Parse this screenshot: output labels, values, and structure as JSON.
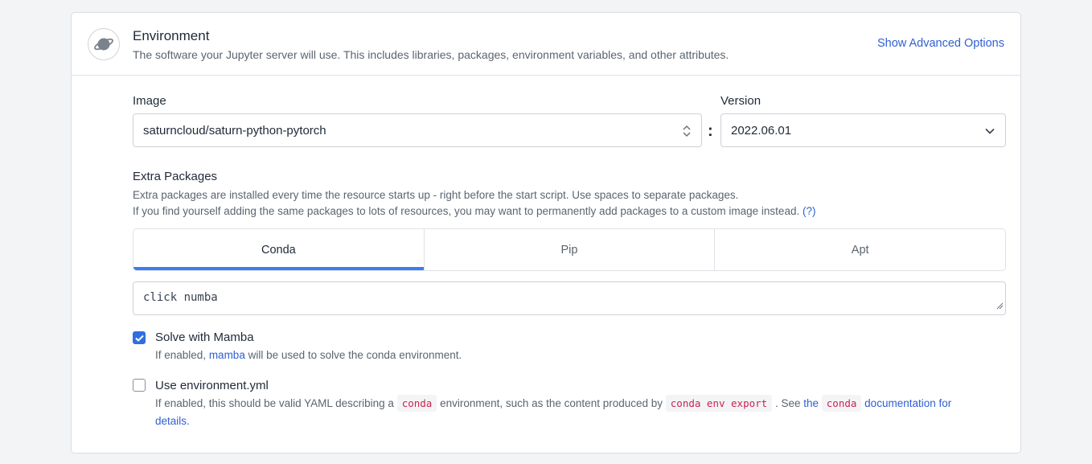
{
  "header": {
    "title": "Environment",
    "description": "The software your Jupyter server will use. This includes libraries, packages, environment variables, and other attributes.",
    "advanced_link": "Show Advanced Options",
    "icon": "planet-icon"
  },
  "image": {
    "label": "Image",
    "value": "saturncloud/saturn-python-pytorch"
  },
  "version": {
    "label": "Version",
    "value": "2022.06.01"
  },
  "separator": ":",
  "extra_packages": {
    "title": "Extra Packages",
    "desc_line1": "Extra packages are installed every time the resource starts up - right before the start script. Use spaces to separate packages.",
    "desc_line2": "If you find yourself adding the same packages to lots of resources, you may want to permanently add packages to a custom image instead.",
    "help": "(?)",
    "tabs": [
      {
        "label": "Conda",
        "active": true
      },
      {
        "label": "Pip",
        "active": false
      },
      {
        "label": "Apt",
        "active": false
      }
    ],
    "input_value": "click numba"
  },
  "mamba": {
    "label": "Solve with Mamba",
    "checked": true,
    "desc_pre": "If enabled, ",
    "desc_link": "mamba",
    "desc_post": " will be used to solve the conda environment."
  },
  "env_yml": {
    "label": "Use environment.yml",
    "checked": false,
    "desc_1": "If enabled, this should be valid YAML describing a ",
    "code_1": "conda",
    "desc_2": " environment, such as the content produced by ",
    "code_2": "conda env export",
    "desc_3": " . See ",
    "link_1": "the",
    "code_3": "conda",
    "link_2": "documentation for details."
  },
  "colors": {
    "accent": "#3b7cf0",
    "link": "#2f5fd0",
    "code": "#c7254e"
  }
}
